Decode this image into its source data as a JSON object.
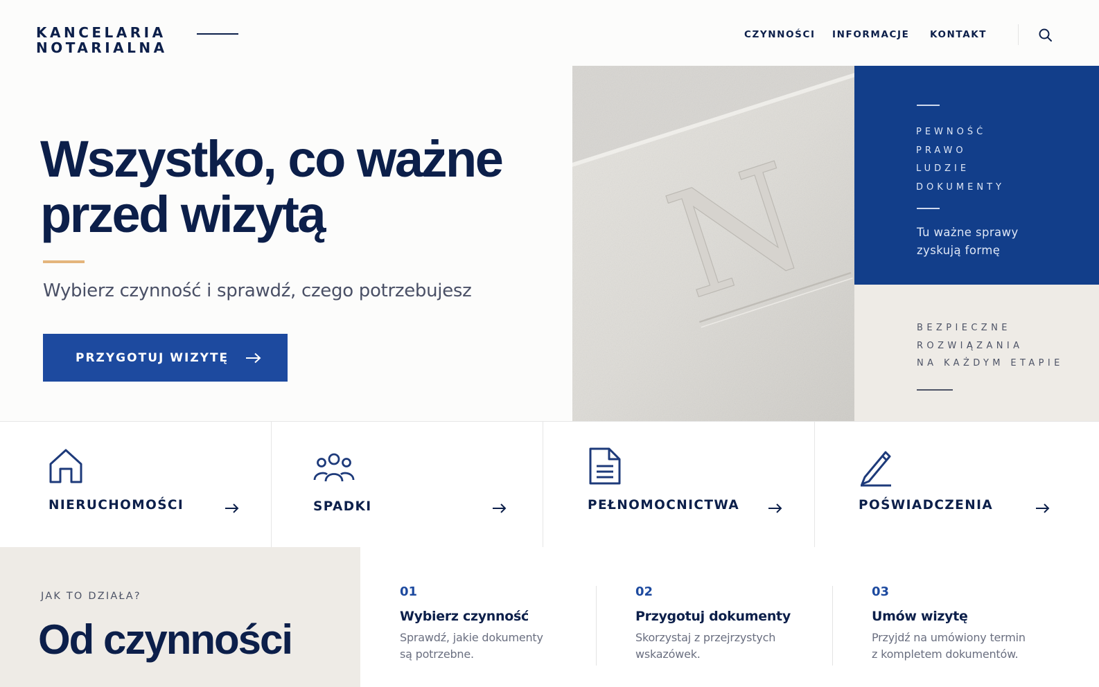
{
  "brand": {
    "line1": "KANCELARIA",
    "line2": "NOTARIALNA"
  },
  "nav": {
    "items": [
      "CZYNNOŚCI",
      "INFORMACJE",
      "KONTAKT"
    ],
    "search_icon": "search-icon"
  },
  "hero": {
    "title_line1": "Wszystko, co ważne",
    "title_line2": "przed wizytą",
    "subtitle": "Wybierz czynność i sprawdź, czego potrzebujesz",
    "cta_label": "PRZYGOTUJ WIZYTĘ"
  },
  "blue_panel": {
    "words": [
      "PEWNOŚĆ",
      "PRAWO",
      "LUDZIE",
      "DOKUMENTY"
    ],
    "tagline_line1": "Tu ważne sprawy",
    "tagline_line2": "zyskują formę"
  },
  "beige_panel": {
    "lines": [
      "BEZPIECZNE",
      "ROZWIĄZANIA",
      "NA KAŻDYM ETAPIE"
    ]
  },
  "photo": {
    "embossed_letter": "N"
  },
  "categories": [
    {
      "label": "NIERUCHOMOŚCI",
      "icon": "house-icon"
    },
    {
      "label": "SPADKI",
      "icon": "people-icon"
    },
    {
      "label": "PEŁNOMOCNICTWA",
      "icon": "document-icon"
    },
    {
      "label": "POŚWIADCZENIA",
      "icon": "pen-icon"
    }
  ],
  "how_it_works": {
    "kicker": "JAK TO DZIAŁA?",
    "title": "Od czynności",
    "steps": [
      {
        "num": "01",
        "title": "Wybierz czynność",
        "desc_line1": "Sprawdź, jakie dokumenty",
        "desc_line2": "są potrzebne."
      },
      {
        "num": "02",
        "title": "Przygotuj dokumenty",
        "desc_line1": "Skorzystaj z przejrzystych",
        "desc_line2": "wskazówek."
      },
      {
        "num": "03",
        "title": "Umów wizytę",
        "desc_line1": "Przyjdź na umówiony termin",
        "desc_line2": "z kompletem dokumentów."
      }
    ]
  },
  "colors": {
    "navy": "#0c1f4a",
    "brand_blue": "#1d4a9f",
    "panel_blue": "#123e8a",
    "accent_gold": "#e4b57c",
    "beige": "#eeebe6"
  }
}
